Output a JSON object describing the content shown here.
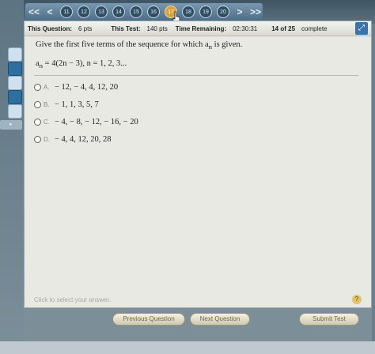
{
  "nav": {
    "prev_all": "<<",
    "prev": "<",
    "numbers": [
      "11",
      "12",
      "13",
      "14",
      "15",
      "16",
      "17",
      "18",
      "19",
      "20"
    ],
    "current": "17",
    "next": ">",
    "next_all": ">>"
  },
  "status": {
    "this_question_label": "This Question:",
    "this_question_value": "6 pts",
    "this_test_label": "This Test:",
    "this_test_value": "140 pts",
    "time_label": "Time Remaining:",
    "time_value": "02:30:31",
    "progress": "14 of 25",
    "progress_suffix": "complete"
  },
  "question": {
    "text_before": "Give the first five terms of the sequence for which a",
    "sub": "n",
    "text_after": " is given.",
    "formula_a": "a",
    "formula_sub": "n",
    "formula_rest": " = 4(2n − 3), n = 1, 2, 3..."
  },
  "choices": [
    {
      "letter": "A.",
      "text": "− 12, − 4, 4, 12, 20"
    },
    {
      "letter": "B.",
      "text": "− 1, 1, 3, 5, 7"
    },
    {
      "letter": "C.",
      "text": "− 4, − 8, − 12, − 16, − 20"
    },
    {
      "letter": "D.",
      "text": "− 4, 4, 12, 20, 28"
    }
  ],
  "footer": {
    "hint": "Click to select your answer.",
    "help": "?"
  },
  "buttons": {
    "previous": "Previous Question",
    "next": "Next Question",
    "submit": "Submit Test"
  }
}
